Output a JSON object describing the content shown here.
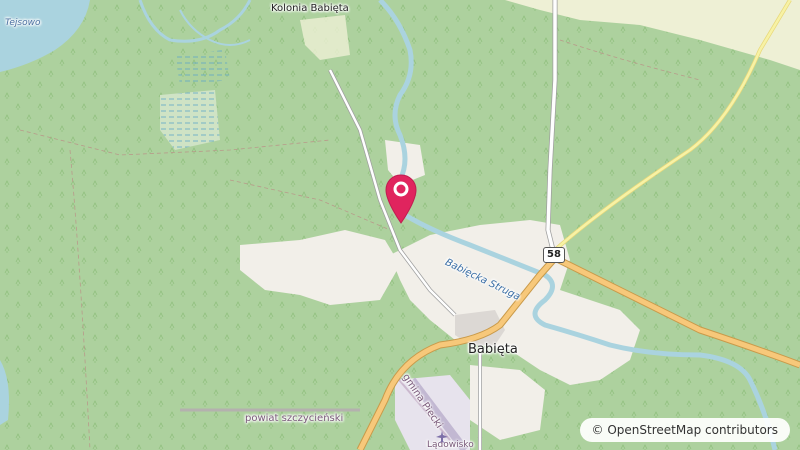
{
  "map": {
    "places": {
      "kolonia": "Kolonia Babięta",
      "village": "Babięta",
      "lake": "Tejsowo"
    },
    "river_name": "Babięcka Struga",
    "road_shield": "58",
    "admin_labels": {
      "powiat": "powiat szczycieński",
      "gmina": "gmina Piecki",
      "airfield": "Lądowisko"
    },
    "attribution": "© OpenStreetMap contributors",
    "colors": {
      "forest": "#add19e",
      "meadow": "#f2efe9",
      "farmland": "#eef0d5",
      "water": "#aad3df",
      "road_major": "#f7c87a",
      "road_minor": "#fefefe",
      "marker": "#e0245e"
    }
  }
}
